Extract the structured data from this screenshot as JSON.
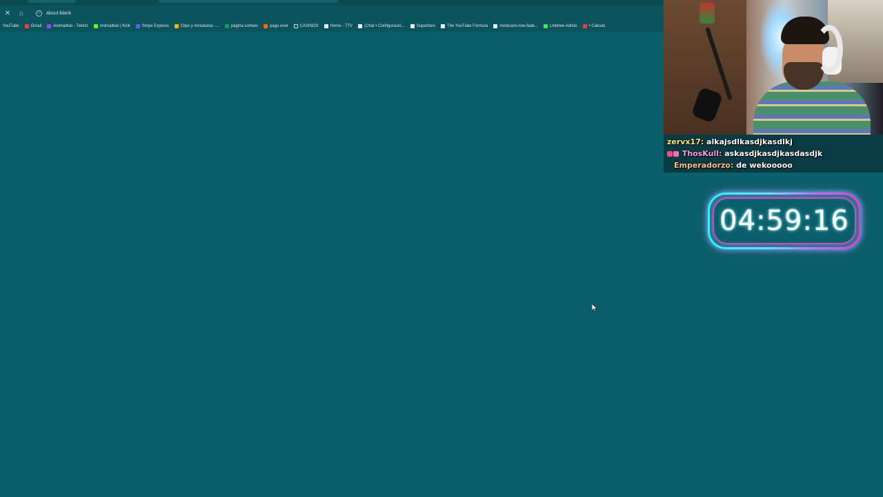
{
  "browser": {
    "close_icon": "close-icon",
    "home_icon": "home-icon",
    "info_icon": "info-icon",
    "url": "about:blank"
  },
  "bookmarks": [
    {
      "label": "YouTube",
      "icon": "youtube-icon",
      "color": "#ff3b3b"
    },
    {
      "label": "Gmail",
      "icon": "gmail-icon",
      "color": "#ea4335"
    },
    {
      "label": "Animalitoo - Twitch",
      "icon": "twitch-icon",
      "color": "#9146ff"
    },
    {
      "label": "Animalitoo | Kick",
      "icon": "kick-icon",
      "color": "#53fc18"
    },
    {
      "label": "Stripe Express",
      "icon": "stripe-icon",
      "color": "#635bff"
    },
    {
      "label": "Clips y miniaturas -...",
      "icon": "drive-icon",
      "color": "#f4b400"
    },
    {
      "label": "página sorteos",
      "icon": "sheets-icon",
      "color": "#0f9d58"
    },
    {
      "label": "pago enel",
      "icon": "enel-icon",
      "color": "#ff6a00"
    },
    {
      "label": "CASINOS",
      "icon": "folder-icon",
      "color": "#cfe0e2"
    },
    {
      "label": "Home - 7TV",
      "icon": "7tv-icon",
      "color": "#e8f3f5"
    },
    {
      "label": "¡Chat • Configuració...",
      "icon": "chat-icon",
      "color": "#e8f3f5"
    },
    {
      "label": "Superfans",
      "icon": "globe-icon",
      "color": "#e8f3f5"
    },
    {
      "label": "The YouTube Formula",
      "icon": "globe-icon",
      "color": "#e8f3f5"
    },
    {
      "label": "mohicano-low-fade...",
      "icon": "globe-icon",
      "color": "#e8f3f5"
    },
    {
      "label": "Linktree Admin",
      "icon": "linktree-icon",
      "color": "#43e660"
    },
    {
      "label": "• Calculo",
      "icon": "chrome-icon",
      "color": "#db4437"
    }
  ],
  "chat": [
    {
      "user": "zervx17",
      "message": "alkajsdlkasdjkasdlkj"
    },
    {
      "user": "ThosKull",
      "message": "askasdjkasdjkasdasdjk"
    },
    {
      "user": "Emperadorzo",
      "message": "de wekooooo"
    }
  ],
  "timer": {
    "value": "04:59:16"
  },
  "colors": {
    "page_background": "#0a5f6a",
    "timer_cyan": "#33f0ff",
    "timer_magenta": "#ff2fd0"
  }
}
